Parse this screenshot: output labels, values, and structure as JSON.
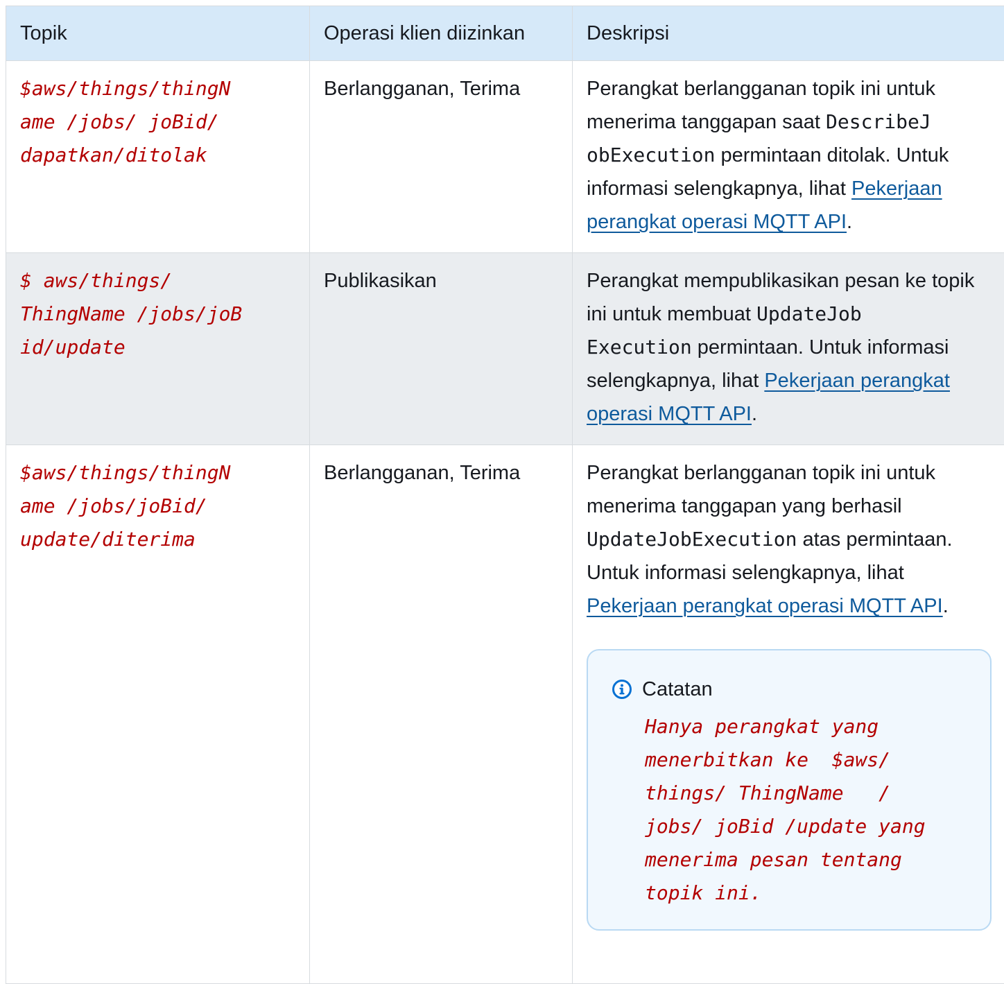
{
  "headers": {
    "topic": "Topik",
    "operations": "Operasi klien diizinkan",
    "description": "Deskripsi"
  },
  "rows": [
    {
      "topic": "$aws/things/thingN\name /jobs/ joBid/\ndapatkan/ditolak",
      "operations": "Berlangganan, Terima",
      "desc_part1": "Perangkat berlangganan topik ini untuk menerima tanggapan saat ",
      "code": "DescribeJ\nobExecution",
      "desc_part2": "  permintaan ditolak. Untuk informasi selengkapnya, lihat ",
      "link": "Pekerjaan perangkat operasi MQTT API",
      "desc_end": "."
    },
    {
      "topic": "$ aws/things/\nThingName /jobs/joB\nid/update",
      "operations": "Publikasikan",
      "desc_part1": "Perangkat mempublikasikan pesan ke topik ini untuk membuat ",
      "code": "UpdateJob\nExecution",
      "desc_part2": "  permintaan. Untuk informasi selengkapnya, lihat ",
      "link": "Pekerjaan perangkat operasi MQTT API",
      "desc_end": "."
    },
    {
      "topic": "$aws/things/thingN\name /jobs/joBid/\nupdate/diterima",
      "operations": "Berlangganan, Terima",
      "desc_part1": "Perangkat berlangganan topik ini untuk menerima tanggapan yang berhasil ",
      "code": "UpdateJobExecution",
      "desc_part2": "  atas permintaan. Untuk informasi selengkapnya, lihat ",
      "link": "Pekerjaan perangkat operasi MQTT API",
      "desc_end": "."
    }
  ],
  "note": {
    "title": "Catatan",
    "icon": "info-icon",
    "body": "Hanya perangkat yang\nmenerbitkan ke  $aws/\nthings/ ThingName   /\njobs/ joBid /update yang\nmenerima pesan tentang\ntopik ini."
  },
  "colors": {
    "header_bg": "#d6e9f9",
    "alt_row_bg": "#eaedf0",
    "topic_text": "#b30000",
    "link": "#0e5a9c",
    "note_border": "#b9d9f3"
  }
}
